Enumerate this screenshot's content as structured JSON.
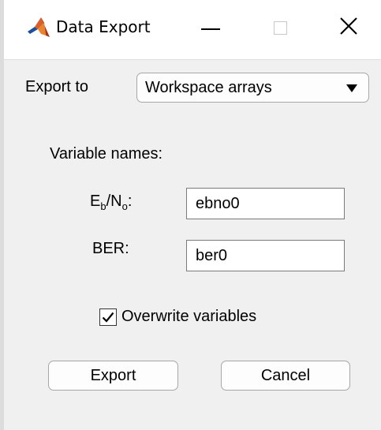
{
  "window": {
    "title": "Data Export",
    "app_icon": "matlab-logo-icon",
    "controls": {
      "minimize_icon": "minimize-icon",
      "maximize_icon": "maximize-icon",
      "close_icon": "close-icon",
      "close_glyph": "✕"
    }
  },
  "export_to": {
    "label": "Export to",
    "selected": "Workspace arrays",
    "arrow_icon": "dropdown-arrow-icon"
  },
  "variable_names": {
    "heading": "Variable names:",
    "ebno": {
      "label_main": "E",
      "label_sub1": "b",
      "label_mid": "/N",
      "label_sub2": "o",
      "label_end": ":",
      "value": "ebno0"
    },
    "ber": {
      "label": "BER:",
      "value": "ber0"
    }
  },
  "overwrite": {
    "label": "Overwrite variables",
    "checked": true,
    "icon": "checkmark-icon"
  },
  "buttons": {
    "export": "Export",
    "cancel": "Cancel"
  },
  "colors": {
    "titlebar_bg": "#ffffff",
    "content_bg": "#f0f0f0",
    "button_border": "#a7a7a7",
    "matlab_red": "#c4451c",
    "matlab_blue": "#1f4e9c"
  }
}
